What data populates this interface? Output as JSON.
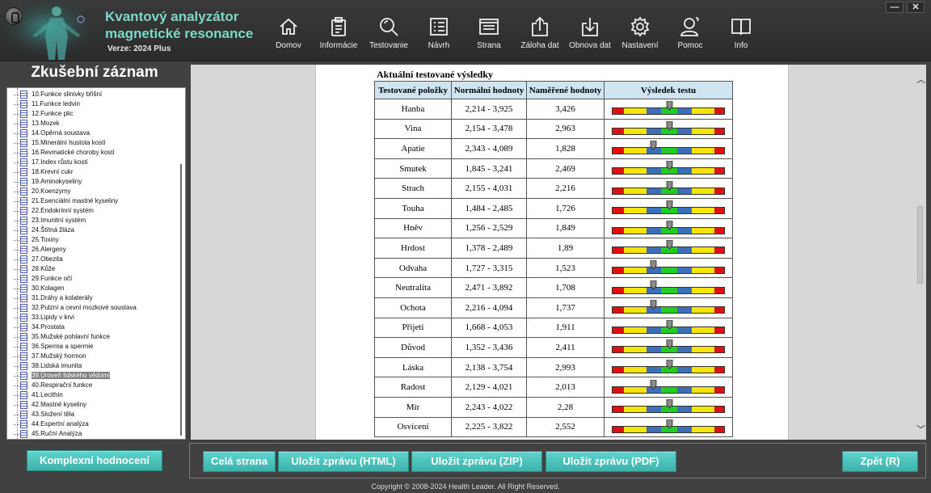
{
  "app": {
    "title_line1": "Kvantový analyzátor",
    "title_line2": "magnetické resonance",
    "version": "Verze: 2024 Plus"
  },
  "nav": [
    {
      "label": "Domov",
      "icon": "home-icon"
    },
    {
      "label": "Informácie",
      "icon": "clipboard-icon"
    },
    {
      "label": "Testovanie",
      "icon": "magnifier-icon"
    },
    {
      "label": "Návrh",
      "icon": "list-icon"
    },
    {
      "label": "Strana",
      "icon": "page-icon"
    },
    {
      "label": "Záloha dat",
      "icon": "upload-icon"
    },
    {
      "label": "Obnova dat",
      "icon": "download-icon"
    },
    {
      "label": "Nastavení",
      "icon": "gear-icon"
    },
    {
      "label": "Pomoc",
      "icon": "help-user-icon"
    },
    {
      "label": "Info",
      "icon": "book-icon"
    }
  ],
  "window": {
    "minimize": "—",
    "close": "✕"
  },
  "left_panel": {
    "title": "Zkušební záznam",
    "items": [
      "10.Funkce slinivky břišní",
      "11.Funkce ledvin",
      "12.Funkce plic",
      "13.Mozek",
      "14.Opěrná soustava",
      "15.Minerální hustota kostí",
      "16.Revmatické choroby kostí",
      "17.Index růstu kostí",
      "18.Krevní cukr",
      "19.Aminokyseliny",
      "20.Koenzymy",
      "21.Esenciální mastné kyseliny",
      "22.Endokrinní systém",
      "23.Imunitní systém",
      "24.Štítná žláza",
      "25.Toxiny",
      "26.Alergeny",
      "27.Obezita",
      "28.Kůže",
      "29.Funkce očí",
      "30.Kolagen",
      "31.Dráhy a kolaterály",
      "32.Pulzní a cevní mozkové soustava",
      "33.Lipidy v krvi",
      "34.Prostata",
      "35.Mužské pohlavní funkce",
      "36.Sperma a spermie",
      "37.Mužský hormon",
      "38.Lidská imunita",
      "39.Úroveň lidského vědomí",
      "40.Respirační funkce",
      "41.Lecithin",
      "42.Mastné kyseliny",
      "43.Složení těla",
      "44.Expertní analýza",
      "45.Ruční Analýza"
    ],
    "selected_index": 29,
    "comprehensive_button": "Komplexní hodnocení"
  },
  "report": {
    "heading": "Aktuální testované výsledky",
    "columns": [
      "Testované položky",
      "Normální hodnoty",
      "Naměřené hodnoty",
      "Výsledek testu"
    ],
    "rows": [
      {
        "item": "Hanba",
        "normal": "2,214 - 3,925",
        "measured": "3,426",
        "level": 0.5
      },
      {
        "item": "Vina",
        "normal": "2,154 - 3,478",
        "measured": "2,963",
        "level": 0.5
      },
      {
        "item": "Apatie",
        "normal": "2,343 - 4,089",
        "measured": "1,828",
        "level": 0.36
      },
      {
        "item": "Smutek",
        "normal": "1,845 - 3,241",
        "measured": "2,469",
        "level": 0.5
      },
      {
        "item": "Strach",
        "normal": "2,155 - 4,031",
        "measured": "2,216",
        "level": 0.5
      },
      {
        "item": "Touha",
        "normal": "1,484 - 2,485",
        "measured": "1,726",
        "level": 0.5
      },
      {
        "item": "Hněv",
        "normal": "1,256 - 2,529",
        "measured": "1,849",
        "level": 0.5
      },
      {
        "item": "Hrdost",
        "normal": "1,378 - 2,489",
        "measured": "1,89",
        "level": 0.5
      },
      {
        "item": "Odvaha",
        "normal": "1,727 - 3,315",
        "measured": "1,523",
        "level": 0.36
      },
      {
        "item": "Neutralita",
        "normal": "2,471 - 3,892",
        "measured": "1,708",
        "level": 0.36
      },
      {
        "item": "Ochota",
        "normal": "2,216 - 4,094",
        "measured": "1,737",
        "level": 0.36
      },
      {
        "item": "Přijetí",
        "normal": "1,668 - 4,053",
        "measured": "1,911",
        "level": 0.5
      },
      {
        "item": "Důvod",
        "normal": "1,352 - 3,436",
        "measured": "2,411",
        "level": 0.5
      },
      {
        "item": "Láska",
        "normal": "2,138 - 3,754",
        "measured": "2,993",
        "level": 0.5
      },
      {
        "item": "Radost",
        "normal": "2,129 - 4,021",
        "measured": "2,013",
        "level": 0.36
      },
      {
        "item": "Mír",
        "normal": "2,243 - 4,022",
        "measured": "2,28",
        "level": 0.5
      },
      {
        "item": "Osvícení",
        "normal": "2,225 - 3,822",
        "measured": "2,552",
        "level": 0.5
      }
    ]
  },
  "bottom": {
    "full_page": "Celá strana",
    "save_html": "Uložit zprávu (HTML)",
    "save_zip": "Uložit zprávu (ZIP)",
    "save_pdf": "Uložit zprávu (PDF)",
    "back": "Zpět (R)"
  },
  "copyright": "Copyright © 2008-2024 Health Leader. All Right Reserved.",
  "colors": {
    "accent": "#4ec3bb",
    "title_teal": "#7ed8c9",
    "gauge_red": "#e01010",
    "gauge_yellow": "#f4e40a",
    "gauge_blue": "#3c6fb8",
    "gauge_green": "#22cc22",
    "table_header": "#cfe6f2"
  }
}
